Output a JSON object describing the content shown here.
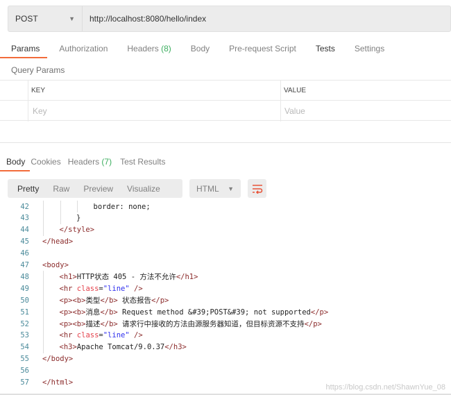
{
  "request": {
    "method": "POST",
    "url": "http://localhost:8080/hello/index"
  },
  "request_tabs": [
    {
      "label": "Params"
    },
    {
      "label": "Authorization"
    },
    {
      "label": "Headers",
      "count": "(8)"
    },
    {
      "label": "Body"
    },
    {
      "label": "Pre-request Script"
    },
    {
      "label": "Tests"
    },
    {
      "label": "Settings"
    }
  ],
  "query_params": {
    "title": "Query Params",
    "key_header": "KEY",
    "value_header": "VALUE",
    "key_placeholder": "Key",
    "value_placeholder": "Value"
  },
  "response_tabs": [
    {
      "label": "Body"
    },
    {
      "label": "Cookies"
    },
    {
      "label": "Headers",
      "count": "(7)"
    },
    {
      "label": "Test Results"
    }
  ],
  "view_modes": [
    "Pretty",
    "Raw",
    "Preview",
    "Visualize"
  ],
  "format": "HTML",
  "accent": "#f26b3a",
  "code_lines": [
    {
      "n": "42",
      "indent": 3,
      "tokens": [
        [
          "text",
          "border: none;"
        ]
      ]
    },
    {
      "n": "43",
      "indent": 2,
      "tokens": [
        [
          "text",
          "}"
        ]
      ]
    },
    {
      "n": "44",
      "indent": 1,
      "tokens": [
        [
          "tag",
          "</style>"
        ]
      ]
    },
    {
      "n": "45",
      "indent": 0,
      "tokens": [
        [
          "tag",
          "</head>"
        ]
      ]
    },
    {
      "n": "46",
      "indent": 0,
      "tokens": []
    },
    {
      "n": "47",
      "indent": 0,
      "tokens": [
        [
          "tag",
          "<body>"
        ]
      ]
    },
    {
      "n": "48",
      "indent": 1,
      "tokens": [
        [
          "tag",
          "<h1>"
        ],
        [
          "text",
          "HTTP状态 405 - 方法不允许"
        ],
        [
          "tag",
          "</h1>"
        ]
      ]
    },
    {
      "n": "49",
      "indent": 1,
      "tokens": [
        [
          "tag",
          "<hr "
        ],
        [
          "attr",
          "class"
        ],
        [
          "text",
          "="
        ],
        [
          "str",
          "\"line\""
        ],
        [
          "tag",
          " />"
        ]
      ]
    },
    {
      "n": "50",
      "indent": 1,
      "tokens": [
        [
          "tag",
          "<p><b>"
        ],
        [
          "text",
          "类型"
        ],
        [
          "tag",
          "</b>"
        ],
        [
          "text",
          " 状态报告"
        ],
        [
          "tag",
          "</p>"
        ]
      ]
    },
    {
      "n": "51",
      "indent": 1,
      "tokens": [
        [
          "tag",
          "<p><b>"
        ],
        [
          "text",
          "消息"
        ],
        [
          "tag",
          "</b>"
        ],
        [
          "text",
          " Request method &#39;POST&#39; not supported"
        ],
        [
          "tag",
          "</p>"
        ]
      ]
    },
    {
      "n": "52",
      "indent": 1,
      "tokens": [
        [
          "tag",
          "<p><b>"
        ],
        [
          "text",
          "描述"
        ],
        [
          "tag",
          "</b>"
        ],
        [
          "text",
          " 请求行中接收的方法由源服务器知道，但目标资源不支持"
        ],
        [
          "tag",
          "</p>"
        ]
      ]
    },
    {
      "n": "53",
      "indent": 1,
      "tokens": [
        [
          "tag",
          "<hr "
        ],
        [
          "attr",
          "class"
        ],
        [
          "text",
          "="
        ],
        [
          "str",
          "\"line\""
        ],
        [
          "tag",
          " />"
        ]
      ]
    },
    {
      "n": "54",
      "indent": 1,
      "tokens": [
        [
          "tag",
          "<h3>"
        ],
        [
          "text",
          "Apache Tomcat/9.0.37"
        ],
        [
          "tag",
          "</h3>"
        ]
      ]
    },
    {
      "n": "55",
      "indent": 0,
      "tokens": [
        [
          "tag",
          "</body>"
        ]
      ]
    },
    {
      "n": "56",
      "indent": 0,
      "tokens": []
    },
    {
      "n": "57",
      "indent": 0,
      "tokens": [
        [
          "tag",
          "</html>"
        ]
      ]
    }
  ],
  "watermark": "https://blog.csdn.net/ShawnYue_08"
}
